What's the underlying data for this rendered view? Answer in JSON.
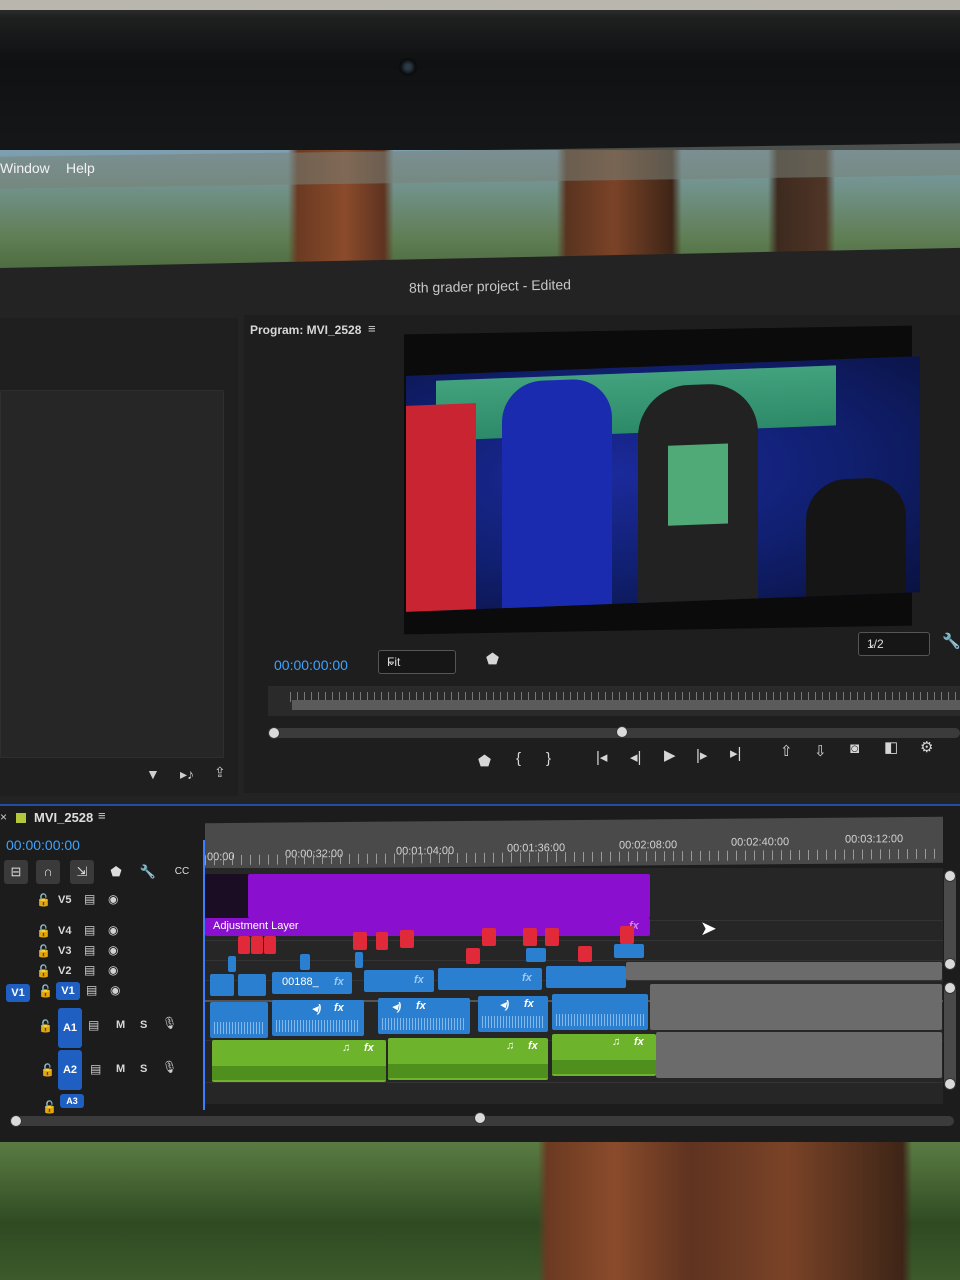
{
  "menubar": {
    "items": [
      "Window",
      "Help"
    ]
  },
  "app": {
    "title": "8th grader project - Edited"
  },
  "program": {
    "panel_title": "Program: MVI_2528",
    "menu_icon": "hamburger-icon",
    "timecode": "00:00:00:00",
    "zoom": "Fit",
    "resolution": "1/2"
  },
  "timeline": {
    "sequence_name": "MVI_2528",
    "timecode": "00:00:00:00",
    "ruler": [
      "00:00",
      "00:00:32:00",
      "00:01:04:00",
      "00:01:36:00",
      "00:02:08:00",
      "00:02:40:00",
      "00:03:12:00"
    ],
    "video_tracks": [
      "V5",
      "V4",
      "V3",
      "V2",
      "V1"
    ],
    "audio_tracks": [
      "A1",
      "A2",
      "A3"
    ],
    "source_patch_video": "V1",
    "mute_label": "M",
    "solo_label": "S",
    "adjustment_clip": "Adjustment Layer",
    "clip_label": "00188_",
    "fx": "fx"
  },
  "colors": {
    "timecode": "#3da3ff",
    "adjustment_layer": "#8b0fcf",
    "video_clip": "#2a7fd0",
    "audio_clip": "#6db32c",
    "graphic_clip": "#e02a3a",
    "track_target": "#1f5fc2"
  }
}
